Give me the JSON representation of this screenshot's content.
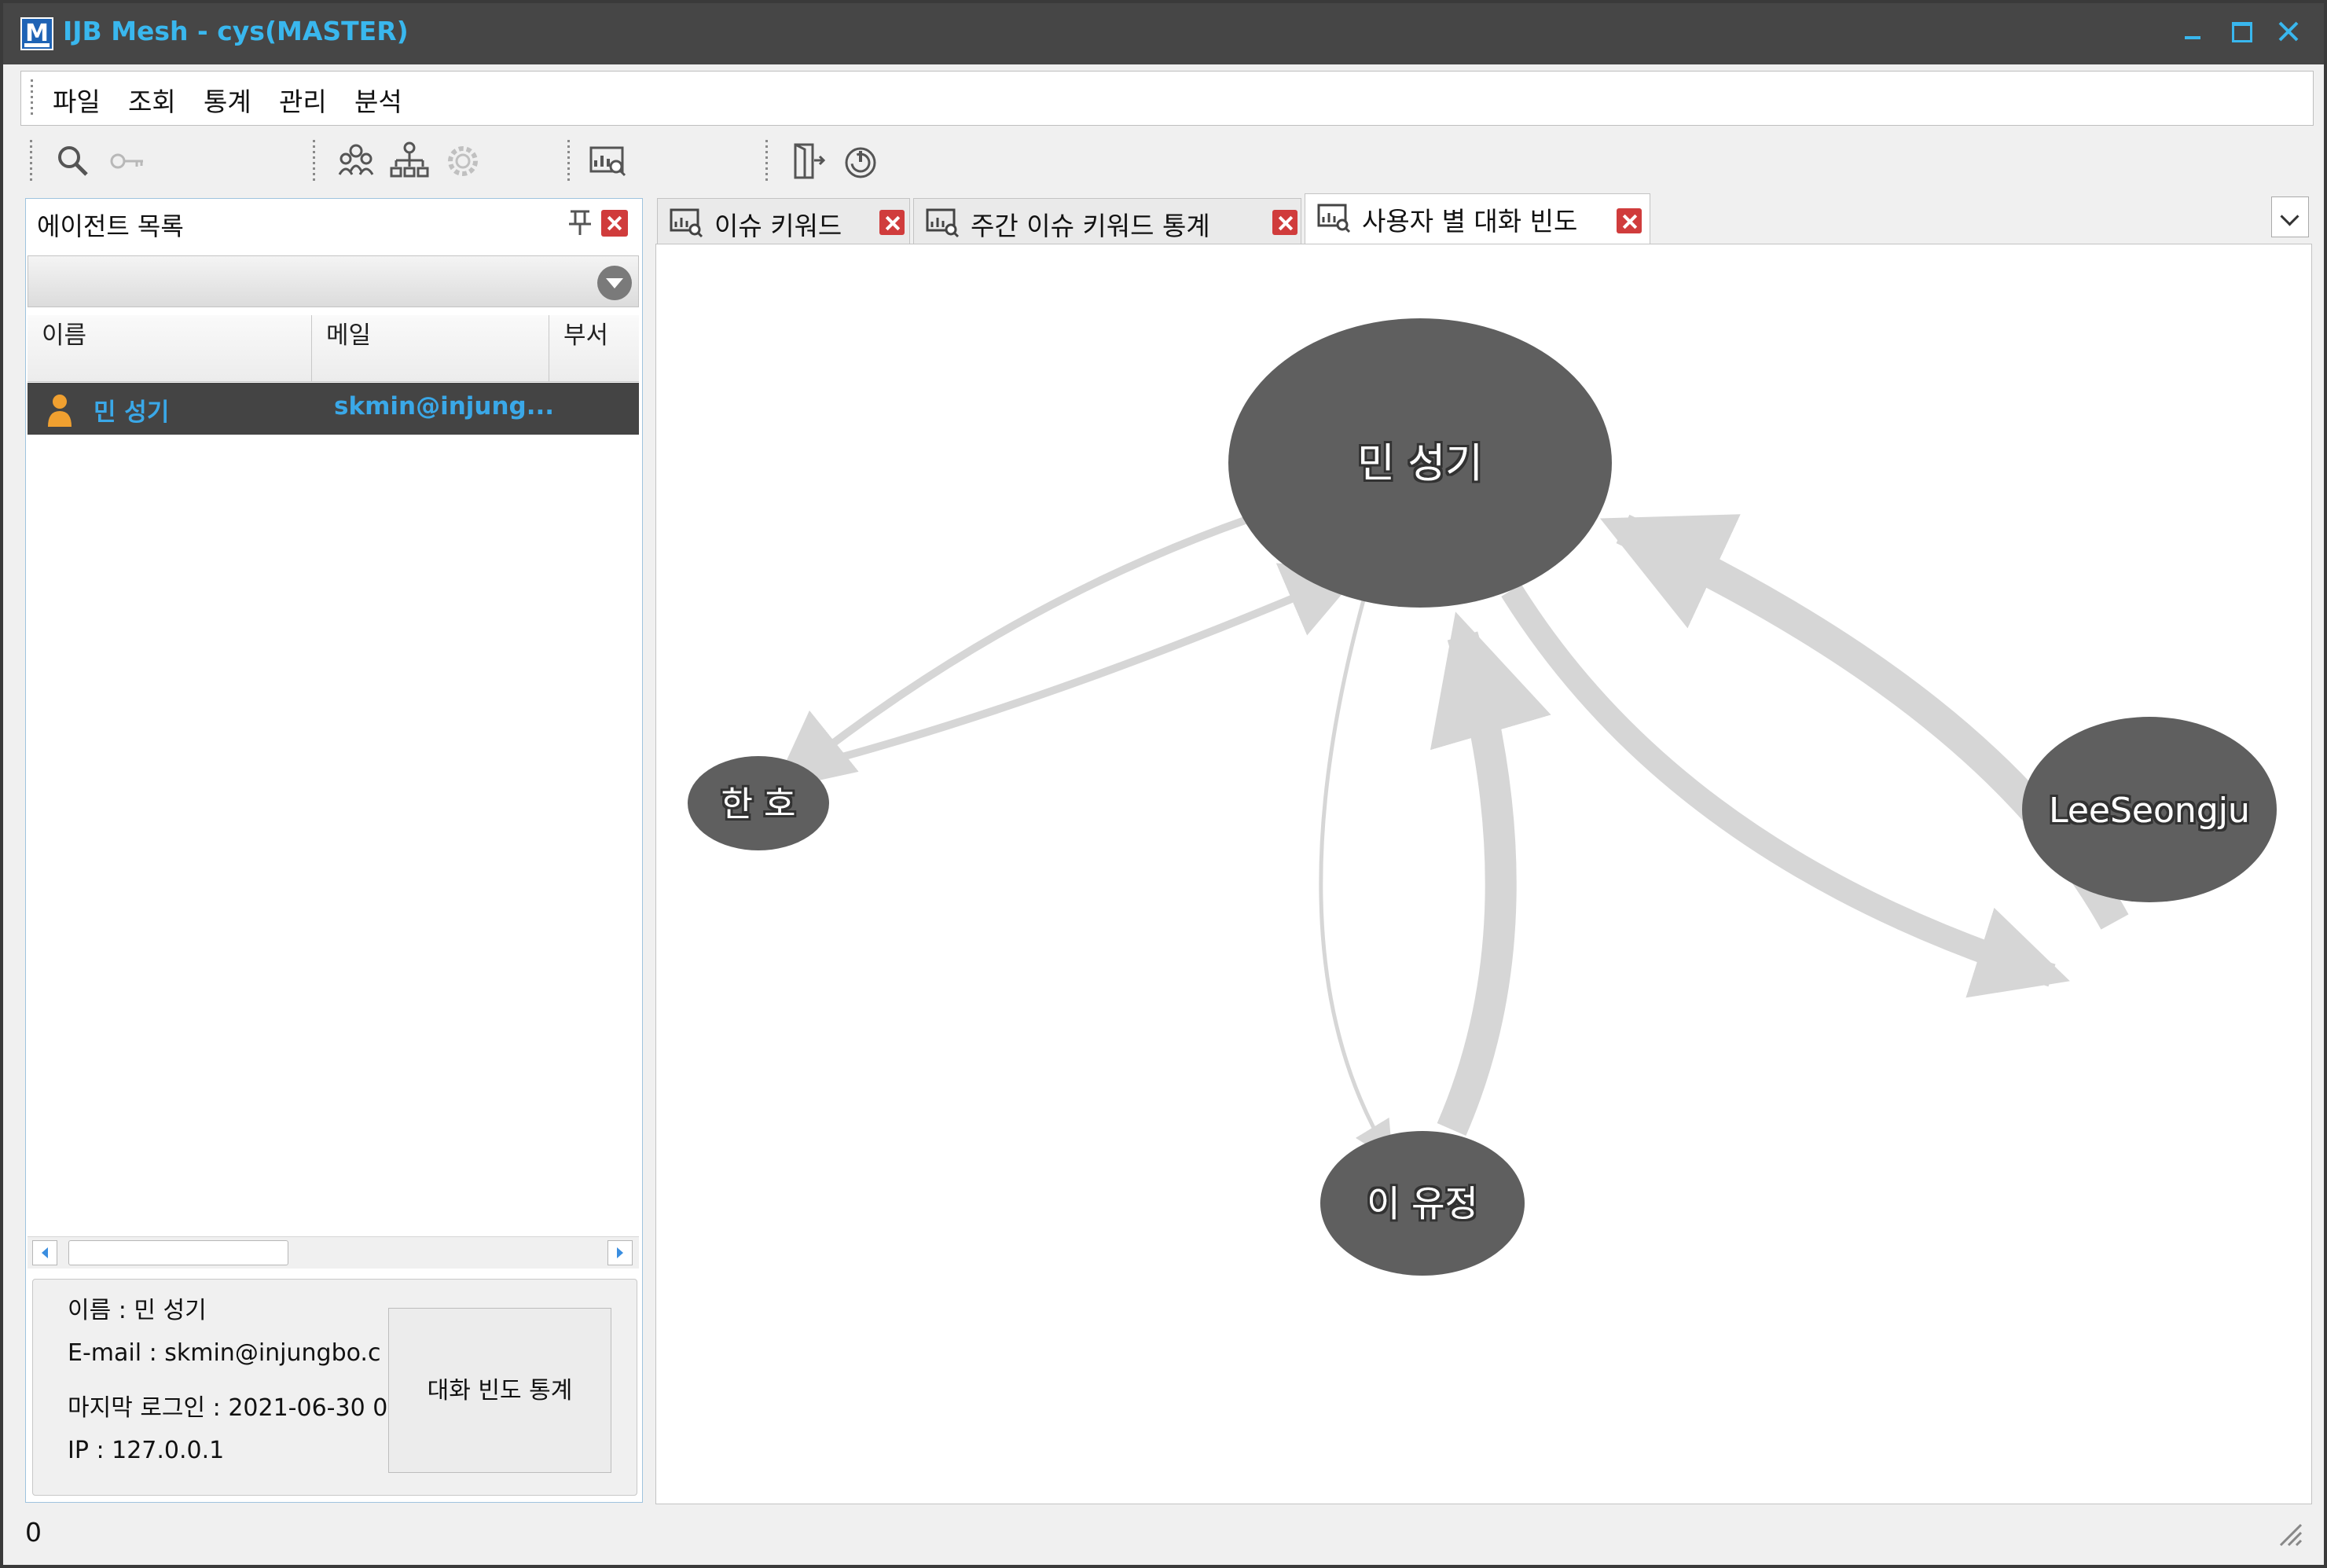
{
  "window": {
    "title": "IJB Mesh - cys(MASTER)",
    "logo_letter": "M",
    "accent": "#39b7ee"
  },
  "menu": {
    "items": [
      "파일",
      "조회",
      "통계",
      "관리",
      "분석"
    ]
  },
  "toolbar": {
    "icons": [
      "search-icon",
      "key-icon",
      "group-icon",
      "org-chart-icon",
      "settings-icon",
      "report-icon",
      "exit-door-icon",
      "power-icon"
    ]
  },
  "agent_panel": {
    "title": "에이전트 목록",
    "columns": [
      "이름",
      "메일",
      "부서"
    ],
    "rows": [
      {
        "name": "민 성기",
        "email": "skmin@injung...",
        "dept": ""
      }
    ],
    "info": {
      "name_line": "이름 : 민 성기",
      "email_line": "E-mail : skmin@injungbo.c",
      "login_line": "마지막 로그인 : 2021-06-30 0",
      "ip_line": "IP : 127.0.0.1"
    },
    "stat_button": "대화 빈도 통계"
  },
  "tabs": [
    {
      "label": "이슈 키워드",
      "active": false
    },
    {
      "label": "주간 이슈 키워드 통계",
      "active": false
    },
    {
      "label": "사용자 별 대화 빈도",
      "active": true
    }
  ],
  "graph": {
    "nodes": [
      {
        "id": "min",
        "label": "민 성기"
      },
      {
        "id": "han",
        "label": "한 호"
      },
      {
        "id": "lee",
        "label": "LeeSeongju"
      },
      {
        "id": "yoo",
        "label": "이 유정"
      }
    ],
    "node_color": "#5f5f5f",
    "edge_color": "#d6d6d6",
    "edges": [
      {
        "from": "min",
        "to": "han",
        "weight": 1
      },
      {
        "from": "han",
        "to": "min",
        "weight": 1
      },
      {
        "from": "min",
        "to": "yoo",
        "weight": 0.5
      },
      {
        "from": "yoo",
        "to": "min",
        "weight": 4
      },
      {
        "from": "min",
        "to": "lee",
        "weight": 3
      },
      {
        "from": "lee",
        "to": "min",
        "weight": 4
      }
    ]
  },
  "status": {
    "text": "0"
  }
}
